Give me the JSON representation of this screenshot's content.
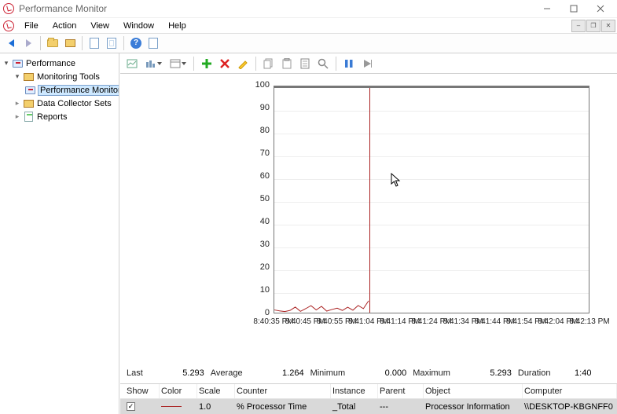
{
  "window": {
    "title": "Performance Monitor"
  },
  "menubar": {
    "items": [
      "File",
      "Action",
      "View",
      "Window",
      "Help"
    ]
  },
  "tree": {
    "root": {
      "label": "Performance"
    },
    "tools": {
      "label": "Monitoring Tools"
    },
    "perfmon": {
      "label": "Performance Monitor"
    },
    "dcs": {
      "label": "Data Collector Sets"
    },
    "reports": {
      "label": "Reports"
    }
  },
  "chart_data": {
    "type": "line",
    "title": "",
    "xlabel": "",
    "ylabel": "",
    "ylim": [
      0,
      100
    ],
    "yticks": [
      0,
      10,
      20,
      30,
      40,
      50,
      60,
      70,
      80,
      90,
      100
    ],
    "xticks": [
      "8:40:35 PM",
      "8:40:45 PM",
      "8:40:55 PM",
      "8:41:04 PM",
      "8:41:14 PM",
      "8:41:24 PM",
      "8:41:34 PM",
      "8:41:44 PM",
      "8:41:54 PM",
      "8:42:04 PM",
      "8:42:13 PM"
    ],
    "now_index": 3,
    "series": [
      {
        "name": "% Processor Time",
        "color": "#a22",
        "values": [
          1.2,
          0.8,
          0.5,
          1.0,
          2.5,
          0.6,
          1.8,
          3.1,
          1.2,
          2.8,
          0.7,
          1.4,
          2.0,
          1.0,
          2.4,
          1.1,
          3.2,
          1.8,
          5.293
        ]
      }
    ]
  },
  "stats": {
    "last_label": "Last",
    "last_value": "5.293",
    "average_label": "Average",
    "average_value": "1.264",
    "minimum_label": "Minimum",
    "minimum_value": "0.000",
    "maximum_label": "Maximum",
    "maximum_value": "5.293",
    "duration_label": "Duration",
    "duration_value": "1:40"
  },
  "counters": {
    "headers": {
      "show": "Show",
      "color": "Color",
      "scale": "Scale",
      "counter": "Counter",
      "instance": "Instance",
      "parent": "Parent",
      "object": "Object",
      "computer": "Computer"
    },
    "rows": [
      {
        "show": true,
        "scale": "1.0",
        "counter": "% Processor Time",
        "instance": "_Total",
        "parent": "---",
        "object": "Processor Information",
        "computer": "\\\\DESKTOP-KBGNFF0"
      }
    ]
  }
}
